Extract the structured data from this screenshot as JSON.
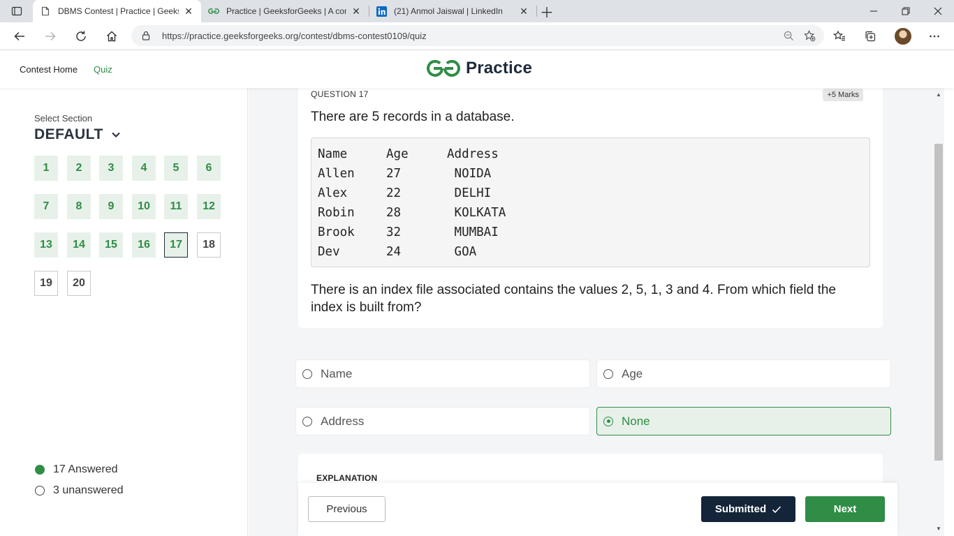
{
  "browser": {
    "tabs": [
      {
        "title": "DBMS Contest | Practice | Geeksf",
        "icon": "page-icon",
        "active": true
      },
      {
        "title": "Practice | GeeksforGeeks | A com",
        "icon": "gfg-icon",
        "active": false
      },
      {
        "title": "(21) Anmol Jaiswal | LinkedIn",
        "icon": "linkedin-icon",
        "active": false
      }
    ],
    "url": "https://practice.geeksforgeeks.org/contest/dbms-contest0109/quiz"
  },
  "header": {
    "nav": [
      "Contest Home",
      "Quiz"
    ],
    "active_nav": "Quiz",
    "brand": "Practice",
    "brand_color": "#2f8d46"
  },
  "sidebar": {
    "select_label": "Select Section",
    "section": "DEFAULT",
    "questions": [
      {
        "n": "1",
        "state": "answered"
      },
      {
        "n": "2",
        "state": "answered"
      },
      {
        "n": "3",
        "state": "answered"
      },
      {
        "n": "4",
        "state": "answered"
      },
      {
        "n": "5",
        "state": "answered"
      },
      {
        "n": "6",
        "state": "answered"
      },
      {
        "n": "7",
        "state": "answered"
      },
      {
        "n": "8",
        "state": "answered"
      },
      {
        "n": "9",
        "state": "answered"
      },
      {
        "n": "10",
        "state": "answered"
      },
      {
        "n": "11",
        "state": "answered"
      },
      {
        "n": "12",
        "state": "answered"
      },
      {
        "n": "13",
        "state": "answered"
      },
      {
        "n": "14",
        "state": "answered"
      },
      {
        "n": "15",
        "state": "answered"
      },
      {
        "n": "16",
        "state": "answered"
      },
      {
        "n": "17",
        "state": "current"
      },
      {
        "n": "18",
        "state": "unanswered"
      },
      {
        "n": "19",
        "state": "unanswered"
      },
      {
        "n": "20",
        "state": "unanswered"
      }
    ],
    "answered_text": "17 Answered",
    "unanswered_text": "3 unanswered"
  },
  "question": {
    "label": "QUESTION 17",
    "marks": "+5 Marks",
    "intro": "There are 5 records in a database.",
    "table": [
      [
        "Name",
        "Age",
        "Address"
      ],
      [
        "Allen",
        "27",
        " NOIDA"
      ],
      [
        "Alex",
        "22",
        " DELHI"
      ],
      [
        "Robin",
        "28",
        " KOLKATA"
      ],
      [
        "Brook",
        "32",
        " MUMBAI"
      ],
      [
        "Dev",
        "24",
        " GOA"
      ]
    ],
    "body": "There is an index file associated contains the values 2, 5, 1, 3 and 4. From which field the index is built from?"
  },
  "options": [
    {
      "label": "Name",
      "selected": false
    },
    {
      "label": "Age",
      "selected": false
    },
    {
      "label": "Address",
      "selected": false
    },
    {
      "label": "None",
      "selected": true
    }
  ],
  "explanation": {
    "title": "EXPLANATION"
  },
  "footer": {
    "previous": "Previous",
    "submitted": "Submitted",
    "next": "Next"
  }
}
